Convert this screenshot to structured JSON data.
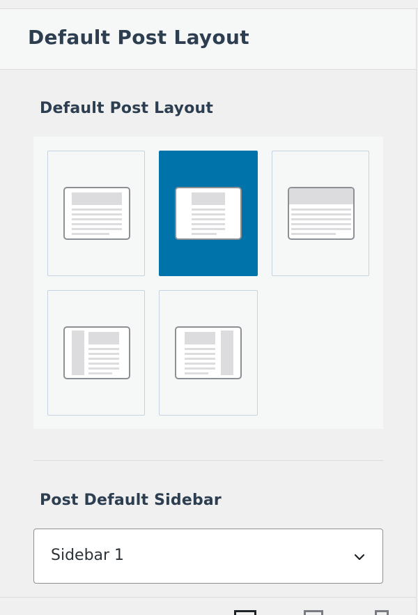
{
  "panel": {
    "title": "Default Post Layout"
  },
  "layout_section": {
    "label": "Default Post Layout",
    "selected_index": 1,
    "options": [
      {
        "id": "full-width-wide",
        "selected": false
      },
      {
        "id": "full-width-narrow",
        "selected": true
      },
      {
        "id": "full-width-header",
        "selected": false
      },
      {
        "id": "left-sidebar",
        "selected": false
      },
      {
        "id": "right-sidebar",
        "selected": false
      }
    ]
  },
  "sidebar_section": {
    "label": "Post Default Sidebar",
    "selected_value": "Sidebar 1"
  },
  "colors": {
    "accent": "#0073aa",
    "icon_border": "#8c8f94",
    "icon_fill": "#dcdcde"
  },
  "icons": [
    "chevron-down-icon"
  ]
}
